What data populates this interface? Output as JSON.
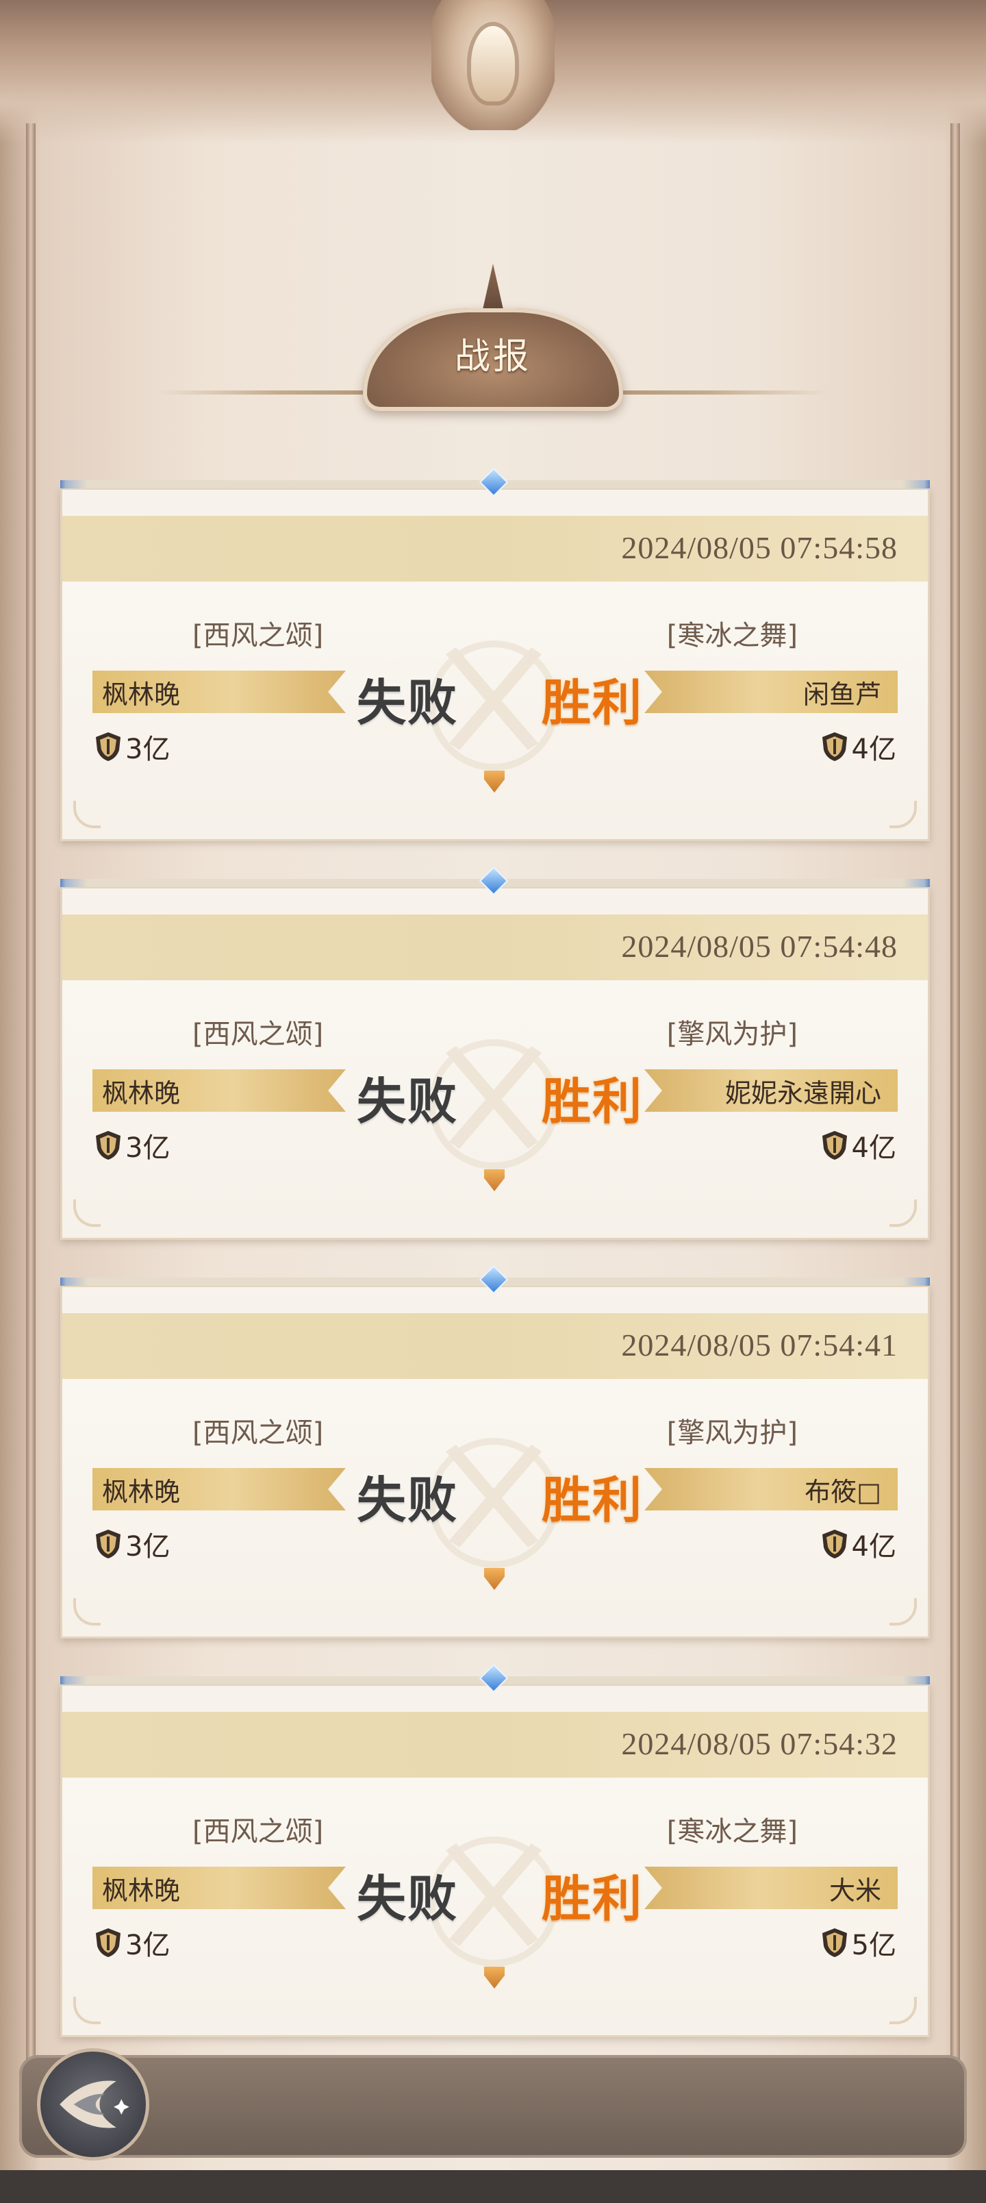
{
  "title": "战报",
  "reports": [
    {
      "time": "2024/08/05 07:54:58",
      "left": {
        "guild": "[西风之颂]",
        "name": "枫林晚",
        "power": "3亿",
        "result": "失败"
      },
      "right": {
        "guild": "[寒冰之舞]",
        "name": "闲鱼芦",
        "power": "4亿",
        "result": "胜利"
      }
    },
    {
      "time": "2024/08/05 07:54:48",
      "left": {
        "guild": "[西风之颂]",
        "name": "枫林晚",
        "power": "3亿",
        "result": "失败"
      },
      "right": {
        "guild": "[擎风为护]",
        "name": "妮妮永遠開心",
        "power": "4亿",
        "result": "胜利"
      }
    },
    {
      "time": "2024/08/05 07:54:41",
      "left": {
        "guild": "[西风之颂]",
        "name": "枫林晚",
        "power": "3亿",
        "result": "失败"
      },
      "right": {
        "guild": "[擎风为护]",
        "name": "布筱□",
        "power": "4亿",
        "result": "胜利"
      }
    },
    {
      "time": "2024/08/05 07:54:32",
      "left": {
        "guild": "[西风之颂]",
        "name": "枫林晚",
        "power": "3亿",
        "result": "失败"
      },
      "right": {
        "guild": "[寒冰之舞]",
        "name": "大米",
        "power": "5亿",
        "result": "胜利"
      }
    }
  ],
  "icons": {
    "back": "back-arrow-icon",
    "power": "power-shield-icon",
    "battle": "crossed-swords-icon"
  },
  "colors": {
    "win": "#e8720f",
    "lose": "#3d3d3d",
    "name_bar": "#e6c785",
    "header_band": "#eadbb4"
  }
}
